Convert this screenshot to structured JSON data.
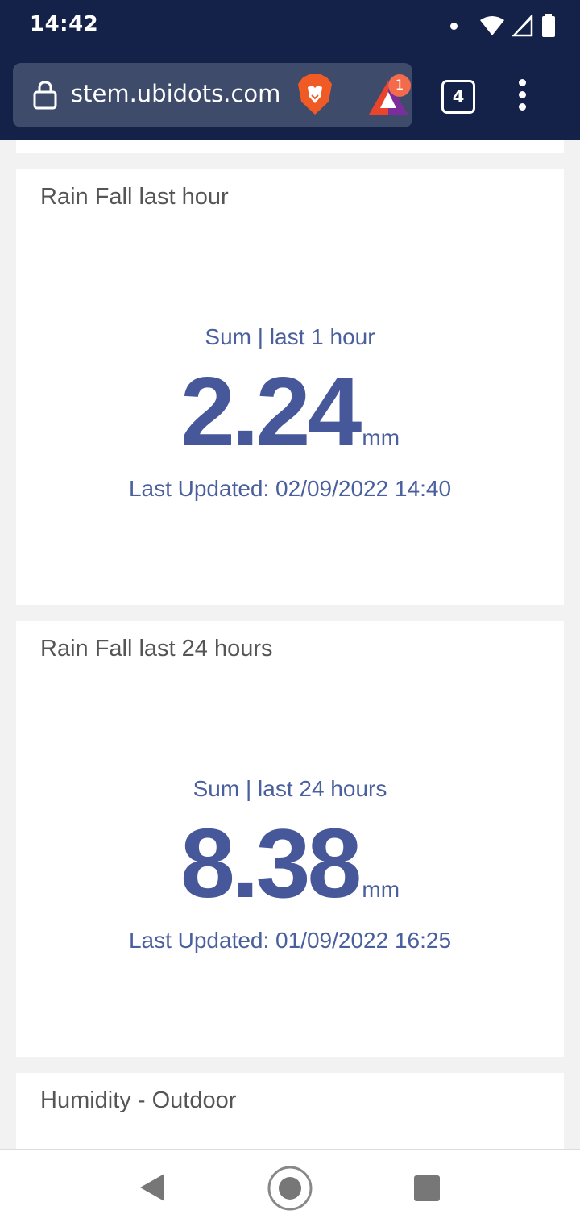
{
  "status_bar": {
    "time": "14:42",
    "icons": [
      "notification-dot-icon",
      "wifi-icon",
      "cell-signal-icon",
      "battery-icon"
    ]
  },
  "browser": {
    "url": "stem.ubidots.com",
    "rewards_badge_count": "1",
    "tab_count": "4",
    "icons": [
      "lock-icon",
      "brave-lion-icon",
      "brave-rewards-icon",
      "overflow-menu-icon"
    ]
  },
  "widgets": [
    {
      "title": "Rain Fall last hour",
      "subtitle": "Sum | last 1 hour",
      "value": "2.24",
      "unit": "mm",
      "updated": "Last Updated: 02/09/2022 14:40"
    },
    {
      "title": "Rain Fall last 24 hours",
      "subtitle": "Sum | last 24 hours",
      "value": "8.38",
      "unit": "mm",
      "updated": "Last Updated: 01/09/2022 16:25"
    },
    {
      "title": "Humidity - Outdoor"
    }
  ],
  "nav": {
    "icons": [
      "back-icon",
      "home-icon",
      "recents-icon"
    ]
  },
  "colors": {
    "header_bg": "#14224a",
    "urlbar_bg": "#3e4b6b",
    "accent_value": "#46589a",
    "badge": "#f36b4a"
  }
}
